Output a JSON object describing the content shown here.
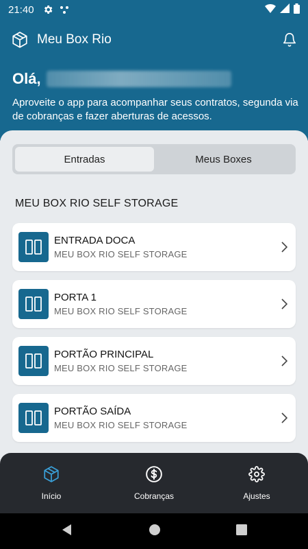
{
  "status_bar": {
    "time": "21:40"
  },
  "app_bar": {
    "title": "Meu Box Rio"
  },
  "greeting": {
    "hello": "Olá,",
    "message": "Aproveite o app para acompanhar seus contratos, segunda via de cobranças e fazer aberturas de acessos."
  },
  "tabs": [
    {
      "label": "Entradas",
      "active": true
    },
    {
      "label": "Meus Boxes",
      "active": false
    }
  ],
  "section": {
    "title": "MEU BOX RIO SELF STORAGE"
  },
  "entries": [
    {
      "name": "ENTRADA DOCA",
      "location": "MEU BOX RIO SELF STORAGE"
    },
    {
      "name": "PORTA 1",
      "location": "MEU BOX RIO SELF STORAGE"
    },
    {
      "name": "PORTÃO PRINCIPAL",
      "location": "MEU BOX RIO SELF STORAGE"
    },
    {
      "name": "PORTÃO SAÍDA",
      "location": "MEU BOX RIO SELF STORAGE"
    }
  ],
  "bottom_nav": [
    {
      "label": "Início",
      "icon": "box-icon",
      "active": true
    },
    {
      "label": "Cobranças",
      "icon": "dollar-icon",
      "active": false
    },
    {
      "label": "Ajustes",
      "icon": "gear-icon",
      "active": false
    }
  ],
  "colors": {
    "primary": "#17688f",
    "background": "#e8ebee",
    "nav_bg": "#26292e",
    "active_nav": "#3aa0d8"
  }
}
